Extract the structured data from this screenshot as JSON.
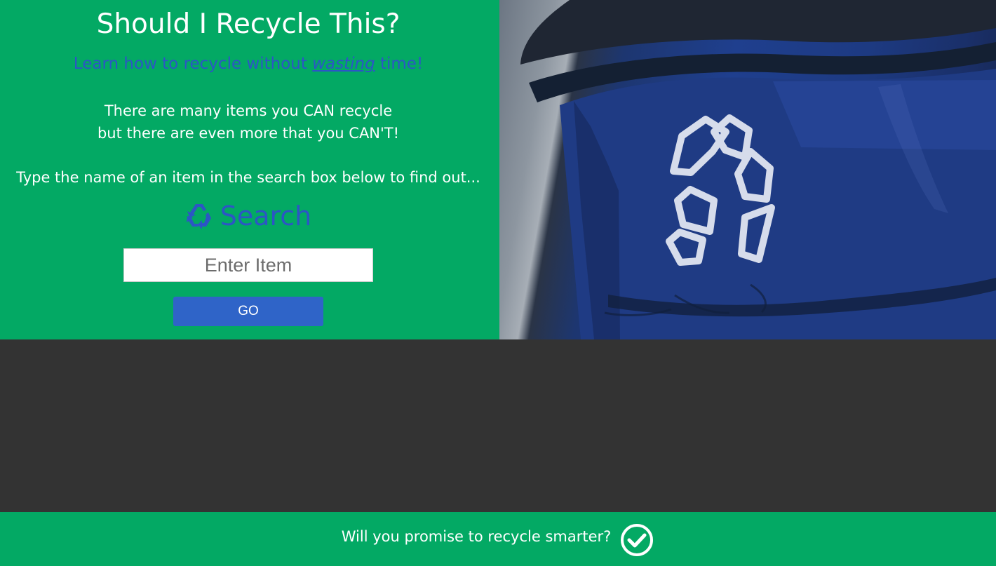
{
  "hero": {
    "title": "Should I Recycle This?",
    "tagline_before": "Learn how to recycle without ",
    "tagline_emphasis": "wasting",
    "tagline_after": " time!",
    "intro_line1": "There are many items you CAN recycle",
    "intro_line2": "but there are even more that you CAN'T!",
    "instruction": "Type the name of an item in the search box below to find out...",
    "search_heading": "Search",
    "search_icon": "recycle-icon"
  },
  "search": {
    "placeholder": "Enter Item",
    "value": "",
    "go_label": "GO"
  },
  "image": {
    "subject": "recycling-bin-photo",
    "icon": "recycle-symbol"
  },
  "footer": {
    "promise_text": "Will you promise to recycle smarter?",
    "promise_icon": "check-circle-icon"
  },
  "colors": {
    "green": "#03a964",
    "blue_text": "#2c56c5",
    "button_blue": "#2f64c8",
    "dark_band": "#333333",
    "white": "#ffffff"
  }
}
